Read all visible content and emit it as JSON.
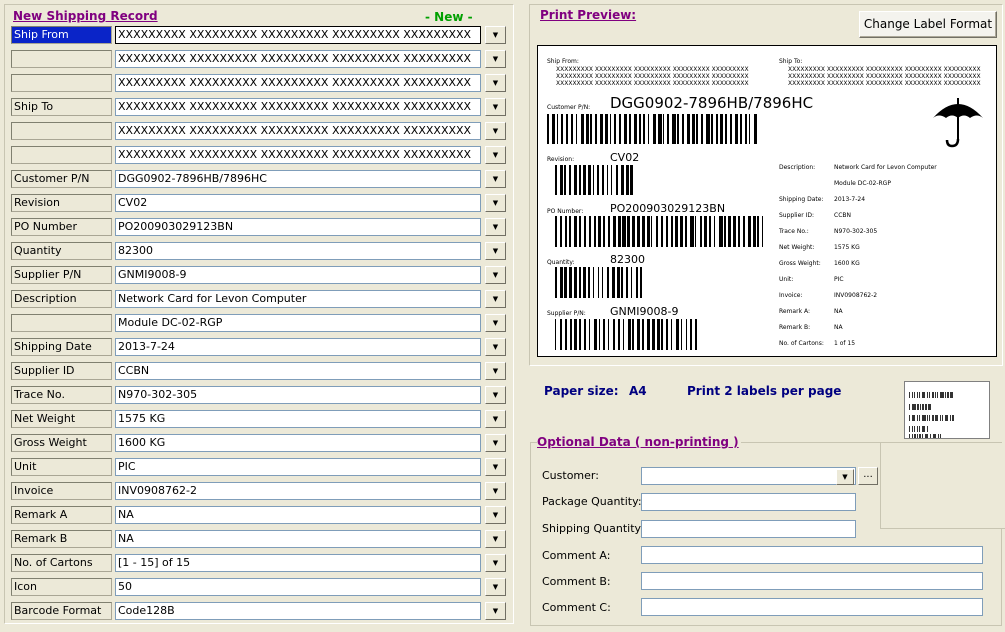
{
  "record": {
    "title": "New Shipping Record",
    "status": "- New -",
    "fields": [
      {
        "label": "Ship From",
        "value": "XXXXXXXXX XXXXXXXXX XXXXXXXXX XXXXXXXXX XXXXXXXXX"
      },
      {
        "label": "",
        "value": "XXXXXXXXX XXXXXXXXX XXXXXXXXX XXXXXXXXX XXXXXXXXX"
      },
      {
        "label": "",
        "value": "XXXXXXXXX XXXXXXXXX XXXXXXXXX XXXXXXXXX XXXXXXXXX"
      },
      {
        "label": "Ship To",
        "value": "XXXXXXXXX XXXXXXXXX XXXXXXXXX XXXXXXXXX XXXXXXXXX"
      },
      {
        "label": "",
        "value": "XXXXXXXXX XXXXXXXXX XXXXXXXXX XXXXXXXXX XXXXXXXXX"
      },
      {
        "label": "",
        "value": "XXXXXXXXX XXXXXXXXX XXXXXXXXX XXXXXXXXX XXXXXXXXX"
      },
      {
        "label": "Customer P/N",
        "value": "DGG0902-7896HB/7896HC"
      },
      {
        "label": "Revision",
        "value": "CV02"
      },
      {
        "label": "PO Number",
        "value": "PO200903029123BN"
      },
      {
        "label": "Quantity",
        "value": "82300"
      },
      {
        "label": "Supplier P/N",
        "value": "GNMI9008-9"
      },
      {
        "label": "Description",
        "value": "Network Card for Levon Computer"
      },
      {
        "label": "",
        "value": "Module DC-02-RGP"
      },
      {
        "label": "Shipping Date",
        "value": "2013-7-24"
      },
      {
        "label": "Supplier ID",
        "value": "CCBN"
      },
      {
        "label": "Trace No.",
        "value": "N970-302-305"
      },
      {
        "label": "Net Weight",
        "value": "1575 KG"
      },
      {
        "label": "Gross Weight",
        "value": "1600 KG"
      },
      {
        "label": "Unit",
        "value": "PIC"
      },
      {
        "label": "Invoice",
        "value": "INV0908762-2"
      },
      {
        "label": "Remark A",
        "value": "NA"
      },
      {
        "label": "Remark B",
        "value": "NA"
      },
      {
        "label": "No. of Cartons",
        "value": "[1 - 15] of 15"
      },
      {
        "label": "Icon",
        "value": "50"
      },
      {
        "label": "Barcode Format",
        "value": "Code128B"
      }
    ]
  },
  "preview": {
    "title": "Print Preview:",
    "change_format_label": "Change Label Format",
    "label": {
      "ship_from_label": "Ship From:",
      "ship_to_label": "Ship To:",
      "address_line": "XXXXXXXXX XXXXXXXXX XXXXXXXXX XXXXXXXXX XXXXXXXXX",
      "customer_pn_label": "Customer P/N:",
      "customer_pn": "DGG0902-7896HB/7896HC",
      "revision_label": "Revision:",
      "revision": "CV02",
      "po_label": "PO Number:",
      "po": "PO200903029123BN",
      "quantity_label": "Quantity:",
      "quantity": "82300",
      "supplier_pn_label": "Supplier P/N:",
      "supplier_pn": "GNMI9008-9",
      "details": [
        {
          "label": "Description:",
          "value": "Network Card for Levon Computer"
        },
        {
          "label": "",
          "value": "Module DC-02-RGP"
        },
        {
          "label": "Shipping Date:",
          "value": "2013-7-24"
        },
        {
          "label": "Supplier ID:",
          "value": "CCBN"
        },
        {
          "label": "Trace No.:",
          "value": "N970-302-305"
        },
        {
          "label": "Net Weight:",
          "value": "1575 KG"
        },
        {
          "label": "Gross Weight:",
          "value": "1600 KG"
        },
        {
          "label": "Unit:",
          "value": "PIC"
        },
        {
          "label": "Invoice:",
          "value": "INV0908762-2"
        },
        {
          "label": "Remark A:",
          "value": "NA"
        },
        {
          "label": "Remark B:",
          "value": "NA"
        },
        {
          "label": "No. of Cartons:",
          "value": "1 of 15"
        }
      ]
    },
    "paper_size_label": "Paper size:",
    "paper_size_value": "A4",
    "labels_per_page": "Print 2 labels per page"
  },
  "optional": {
    "title": "Optional Data  ( non-printing )",
    "customer_label": "Customer:",
    "customer_value": "",
    "browse_label": "...",
    "package_qty_label": "Package Quantity:",
    "package_qty_value": "",
    "shipping_qty_label": "Shipping Quantity:",
    "shipping_qty_value": "",
    "comment_a_label": "Comment A:",
    "comment_a_value": "",
    "comment_b_label": "Comment B:",
    "comment_b_value": "",
    "comment_c_label": "Comment C:",
    "comment_c_value": ""
  },
  "icons": {
    "dropdown": "chevron-down-icon",
    "label_symbol": "umbrella-icon"
  }
}
